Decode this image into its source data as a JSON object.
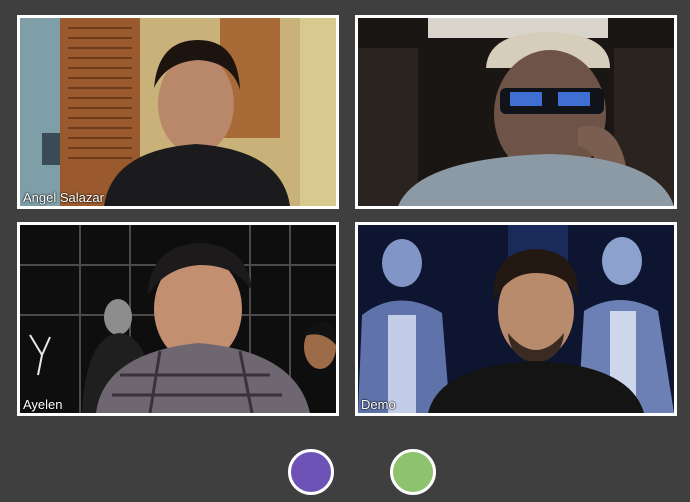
{
  "participants": [
    {
      "name": "Angel Salazar"
    },
    {
      "name": ""
    },
    {
      "name": "Ayelen"
    },
    {
      "name": "Demo"
    }
  ],
  "controls": {
    "left_button_color": "#6f52b5",
    "right_button_color": "#8ec26e"
  }
}
